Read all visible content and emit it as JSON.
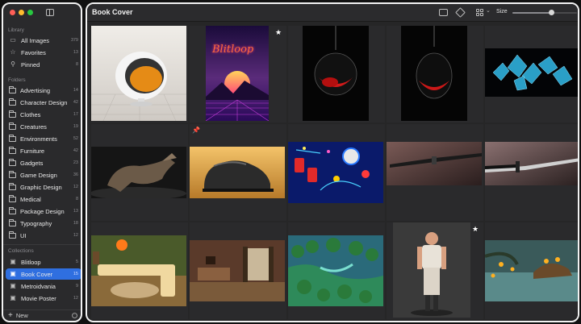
{
  "window": {
    "title": "Book Cover"
  },
  "sidebar": {
    "library_title": "Library",
    "library": [
      {
        "label": "All Images",
        "count": "379",
        "icon": "all-images-icon"
      },
      {
        "label": "Favorites",
        "count": "13",
        "icon": "star-icon"
      },
      {
        "label": "Pinned",
        "count": "8",
        "icon": "pin-icon"
      }
    ],
    "folders_title": "Folders",
    "folders": [
      {
        "label": "Advertising",
        "count": "14"
      },
      {
        "label": "Character Design",
        "count": "42"
      },
      {
        "label": "Clothes",
        "count": "17"
      },
      {
        "label": "Creatures",
        "count": "19"
      },
      {
        "label": "Environments",
        "count": "52"
      },
      {
        "label": "Furniture",
        "count": "42"
      },
      {
        "label": "Gadgets",
        "count": "23"
      },
      {
        "label": "Game Design",
        "count": "36"
      },
      {
        "label": "Graphic Design",
        "count": "12"
      },
      {
        "label": "Medical",
        "count": "8"
      },
      {
        "label": "Package Design",
        "count": "13"
      },
      {
        "label": "Typography",
        "count": "18"
      },
      {
        "label": "UI",
        "count": "12"
      }
    ],
    "collections_title": "Collections",
    "collections": [
      {
        "label": "Blitloop",
        "count": "5"
      },
      {
        "label": "Book Cover",
        "count": "15",
        "active": true
      },
      {
        "label": "Metroidvania",
        "count": "9"
      },
      {
        "label": "Movie Poster",
        "count": "12"
      }
    ],
    "new_label": "New"
  },
  "toolbar": {
    "size_label": "Size",
    "size_value": 0.6,
    "icons": [
      "gallery-icon",
      "cube-icon",
      "grid-view-icon",
      "chevron-down-icon"
    ]
  },
  "grid": {
    "poster_text": "Blitloop",
    "items": [
      {
        "name": "egg-chair",
        "badge": ""
      },
      {
        "name": "blitloop-poster",
        "badge": "star"
      },
      {
        "name": "red-glass-chair-a",
        "badge": ""
      },
      {
        "name": "red-glass-chair-b",
        "badge": ""
      },
      {
        "name": "crystal-shards",
        "badge": ""
      },
      {
        "name": "creature-sculpt",
        "badge": ""
      },
      {
        "name": "boot",
        "badge": "pin"
      },
      {
        "name": "pinball-arcade",
        "badge": ""
      },
      {
        "name": "katana-a",
        "badge": ""
      },
      {
        "name": "katana-b",
        "badge": ""
      },
      {
        "name": "retro-living-room",
        "badge": ""
      },
      {
        "name": "cozy-interior",
        "badge": ""
      },
      {
        "name": "forest-diorama",
        "badge": ""
      },
      {
        "name": "standing-man",
        "badge": "star"
      },
      {
        "name": "lantern-turtle",
        "badge": ""
      }
    ]
  },
  "colors": {
    "accent": "#2f6fe0",
    "background": "#262627",
    "sidebar": "#2a2a2c"
  }
}
